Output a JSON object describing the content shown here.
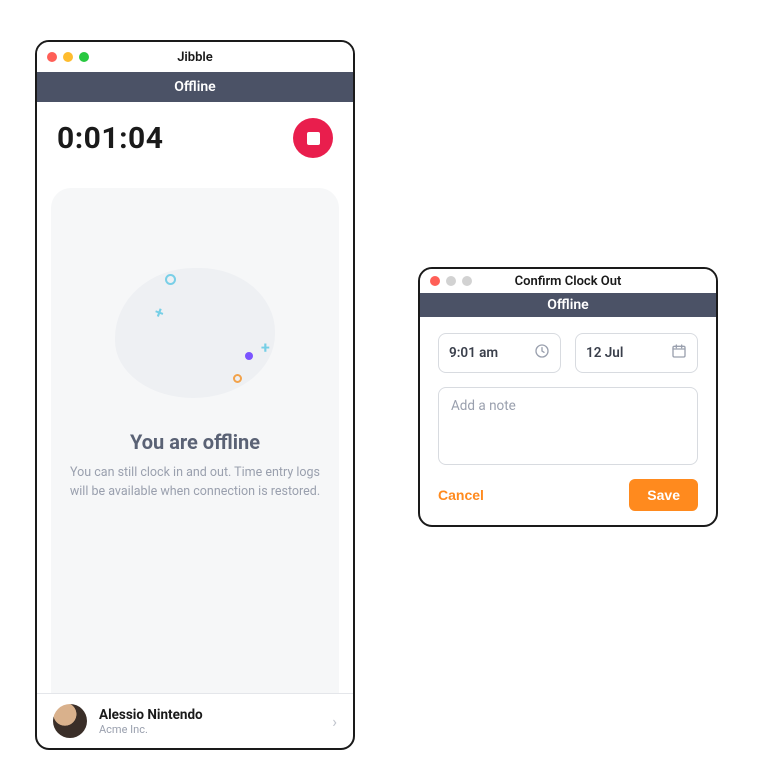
{
  "main": {
    "title": "Jibble",
    "status": "Offline",
    "timer": "0:01:04",
    "offline_heading": "You are offline",
    "offline_desc": "You can still clock in and out. Time entry logs will be available when connection is restored.",
    "user": {
      "name": "Alessio Nintendo",
      "org": "Acme Inc."
    }
  },
  "dialog": {
    "title": "Confirm Clock Out",
    "status": "Offline",
    "time": "9:01 am",
    "date": "12 Jul",
    "note_placeholder": "Add a note",
    "cancel": "Cancel",
    "save": "Save"
  }
}
